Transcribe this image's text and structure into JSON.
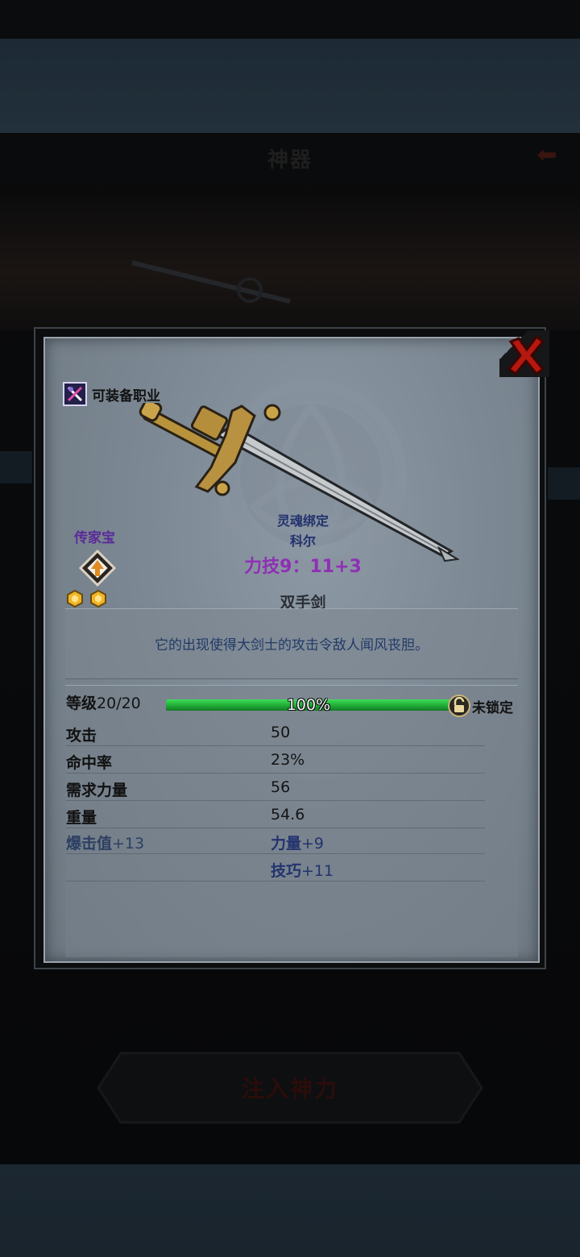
{
  "background": {
    "title": "神器",
    "inject_button_label": "注入神力"
  },
  "item": {
    "equip_class_label": "可装备职业",
    "heirloom_label": "传家宝",
    "soul_bound_label": "灵魂绑定",
    "soul_bound_owner": "科尔",
    "scaling": "力技9：11+3",
    "weapon_type": "双手剑",
    "description": "它的出现使得大剑士的攻击令敌人闻风丧胆。",
    "gem_count": 2
  },
  "level": {
    "label": "等级",
    "value": "20/20",
    "progress_text": "100%",
    "progress_fraction": 1.0,
    "lock_label": "未锁定"
  },
  "stats": [
    {
      "name": "攻击",
      "value": "50"
    },
    {
      "name": "命中率",
      "value": "23%"
    },
    {
      "name": "需求力量",
      "value": "56"
    },
    {
      "name": "重量",
      "value": "54.6"
    }
  ],
  "bonus": {
    "crit_name": "爆击值",
    "crit_value": "+13",
    "str_name": "力量",
    "str_value": "+9",
    "dex_name": "技巧",
    "dex_value": "+11"
  },
  "colors": {
    "xp_fill": "#1ea633",
    "close_red": "#b5180f",
    "heirloom_purple": "#5a2a9a",
    "scaling_purple": "#8f2fb5",
    "bonus_blue": "#23336e"
  },
  "icons": {
    "equip_class": "crossed-weapons-icon",
    "heirloom": "heirloom-upgrade-icon",
    "gem": "gold-gem-icon",
    "lock": "padlock-icon",
    "close": "close-x-icon",
    "weapon": "two-handed-sword"
  }
}
